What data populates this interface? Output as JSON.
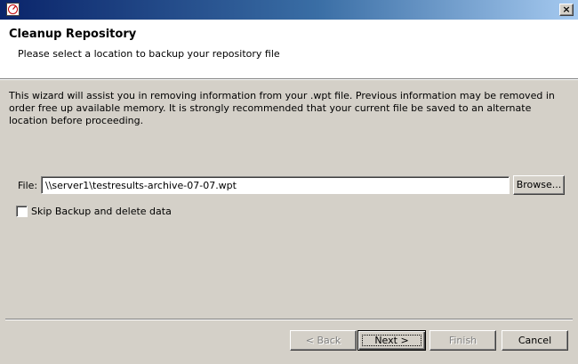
{
  "window": {
    "icon": "app-gauge-icon",
    "close_icon": "close-icon",
    "close_label": "×"
  },
  "header": {
    "title": "Cleanup Repository",
    "subtitle": "Please select a location to backup your repository file"
  },
  "body": {
    "description": "This wizard will assist you in removing information from your .wpt file. Previous information may be removed in order free up available memory. It is strongly recommended that your current file be saved to an alternate location before proceeding."
  },
  "file": {
    "label": "File:",
    "value": "\\\\server1\\testresults-archive-07-07.wpt",
    "browse_label": "Browse..."
  },
  "skip_backup": {
    "label": "Skip Backup and delete data",
    "checked": false
  },
  "buttons": {
    "back_label": "< Back",
    "next_label": "Next >",
    "finish_label": "Finish",
    "cancel_label": "Cancel",
    "back_enabled": false,
    "finish_enabled": false
  }
}
